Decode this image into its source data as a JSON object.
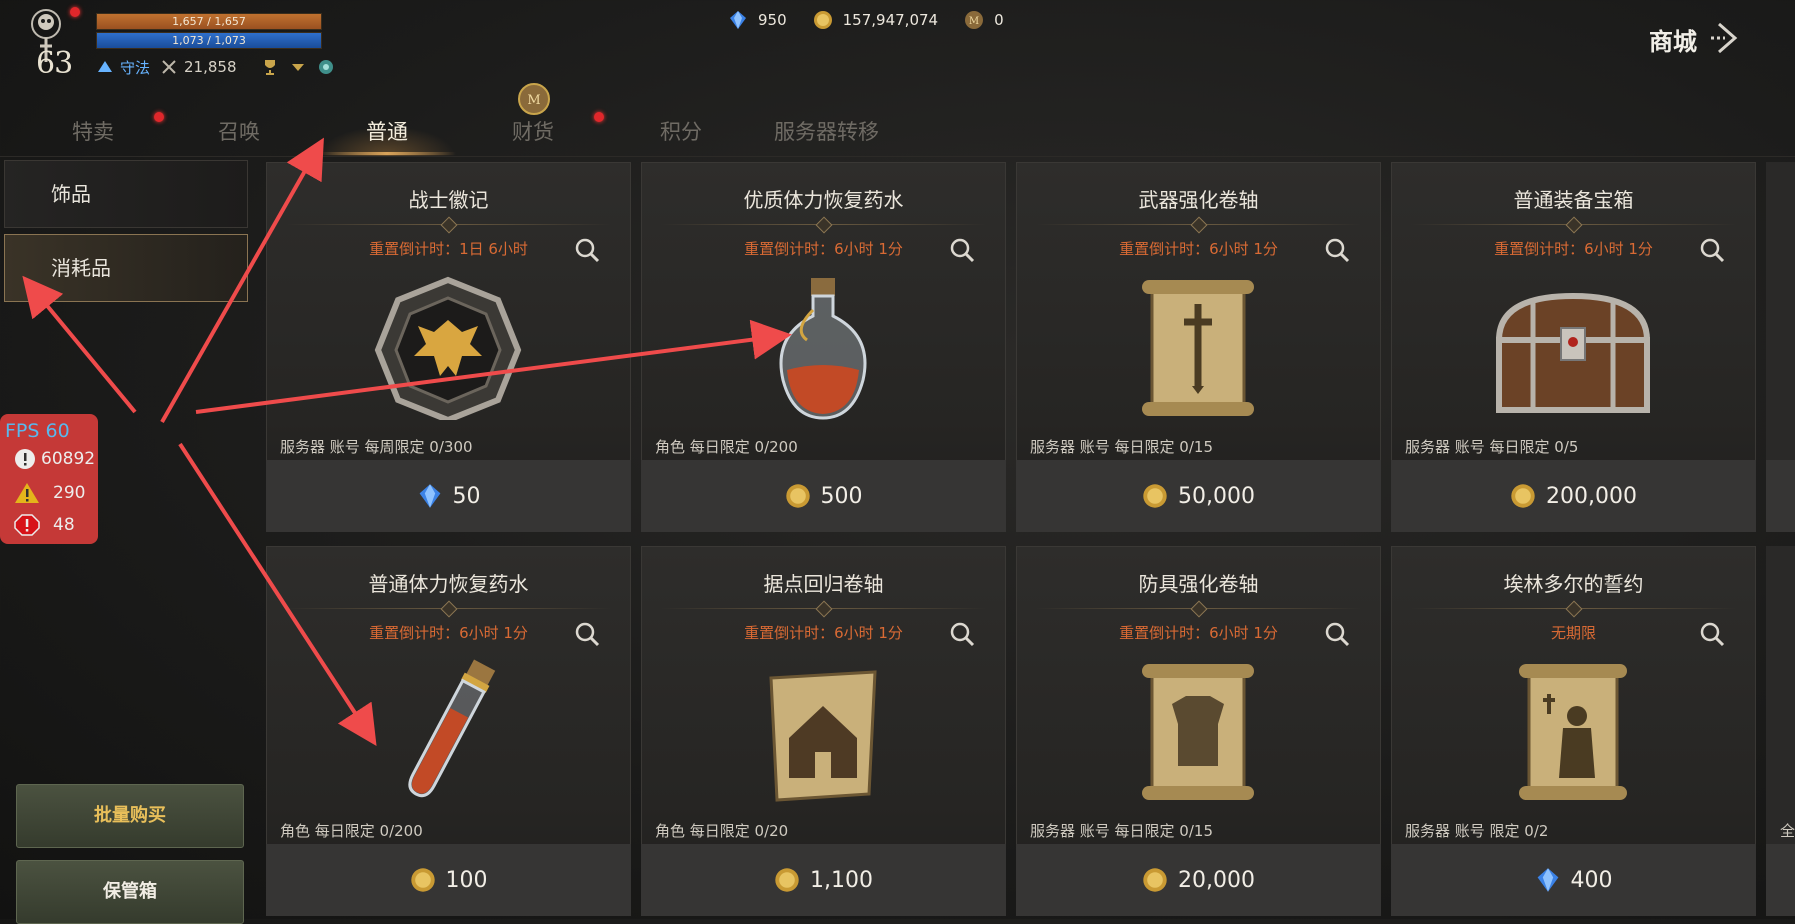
{
  "player": {
    "level": "63",
    "hp": "1,657 / 1,657",
    "mp": "1,073 / 1,073",
    "guild": "守法",
    "combat_power": "21,858"
  },
  "currencies": [
    {
      "icon": "blue-crystal-icon",
      "value": "950"
    },
    {
      "icon": "gold-coin-icon",
      "value": "157,947,074"
    },
    {
      "icon": "medal-coin-icon",
      "value": "0"
    }
  ],
  "shop": {
    "title": "商城"
  },
  "tabs": [
    {
      "label": "特卖",
      "badge": true
    },
    {
      "label": "召唤",
      "badge": false
    },
    {
      "label": "普通",
      "badge": false,
      "active": true
    },
    {
      "label": "财货",
      "badge": true
    },
    {
      "label": "积分",
      "badge": false
    },
    {
      "label": "服务器转移",
      "badge": false
    }
  ],
  "sidebar": {
    "items": [
      {
        "label": "饰品",
        "active": false
      },
      {
        "label": "消耗品",
        "active": true
      }
    ],
    "bulk_buy": "批量购买",
    "storage": "保管箱"
  },
  "fps": {
    "title": "FPS 60",
    "info": "60892",
    "warn": "290",
    "error": "48"
  },
  "items": [
    {
      "name": "战士徽记",
      "timer": "重置倒计时：1日 6小时",
      "limit": "服务器 账号 每周限定 0/300",
      "currency": "blue-crystal-icon",
      "price": "50",
      "art": "eagle-emblem"
    },
    {
      "name": "优质体力恢复药水",
      "timer": "重置倒计时：6小时 1分",
      "limit": "角色 每日限定 0/200",
      "currency": "gold-coin-icon",
      "price": "500",
      "art": "potion-flask"
    },
    {
      "name": "武器强化卷轴",
      "timer": "重置倒计时：6小时 1分",
      "limit": "服务器 账号 每日限定 0/15",
      "currency": "gold-coin-icon",
      "price": "50,000",
      "art": "scroll-sword"
    },
    {
      "name": "普通装备宝箱",
      "timer": "重置倒计时：6小时 1分",
      "limit": "服务器 账号 每日限定 0/5",
      "currency": "gold-coin-icon",
      "price": "200,000",
      "art": "treasure-chest"
    },
    {
      "name": "普通体力恢复药水",
      "timer": "重置倒计时：6小时 1分",
      "limit": "角色 每日限定 0/200",
      "currency": "gold-coin-icon",
      "price": "100",
      "art": "potion-vial"
    },
    {
      "name": "据点回归卷轴",
      "timer": "重置倒计时：6小时 1分",
      "limit": "角色 每日限定 0/20",
      "currency": "gold-coin-icon",
      "price": "1,100",
      "art": "scroll-house"
    },
    {
      "name": "防具强化卷轴",
      "timer": "重置倒计时：6小时 1分",
      "limit": "服务器 账号 每日限定 0/15",
      "currency": "gold-coin-icon",
      "price": "20,000",
      "art": "scroll-armor"
    },
    {
      "name": "埃林多尔的誓约",
      "timer": "无期限",
      "limit": "服务器 账号 限定 0/2",
      "currency": "blue-crystal-icon",
      "price": "400",
      "art": "scroll-knight"
    }
  ],
  "edge_text": "全",
  "colors": {
    "timer": "#d96a34",
    "accent": "#d9a35a",
    "arrow": "#ef4b4b",
    "fps_bg": "#d43c3a"
  }
}
